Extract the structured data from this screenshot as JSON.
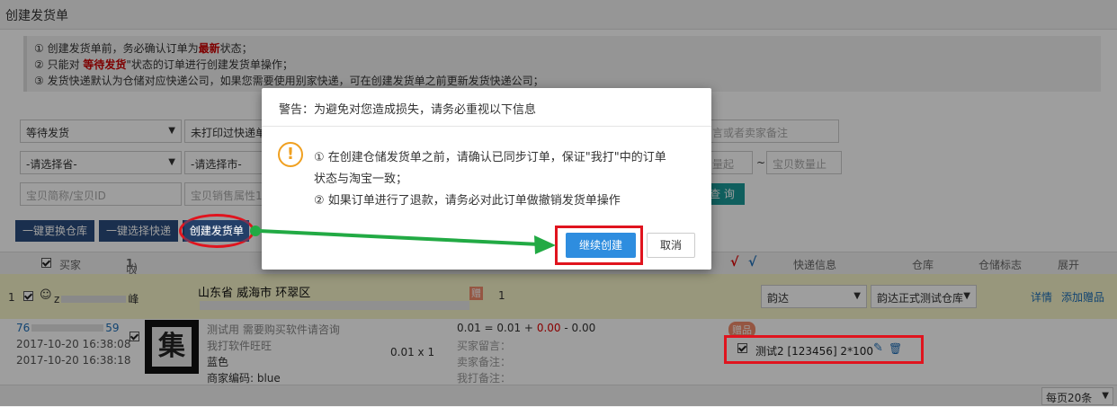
{
  "page_title": "创建发货单",
  "notice": {
    "line1_pre": "① 创建发货单前，务必确认订单为",
    "line1_em": "最新",
    "line1_post": "状态；",
    "line2_pre": "② 只能对 ",
    "line2_em": "等待发货",
    "line2_post": "\"状态的订单进行创建发货单操作；",
    "line3": "③ 发货快递默认为仓储对应快递公司，如果您需要使用别家快递，可在创建发货单之前更新发货快递公司；"
  },
  "filters": {
    "status_select": "等待发货",
    "print_select": "未打印过快递单",
    "province_select": "-请选择省-",
    "city_select": "-请选择市-",
    "remark_placeholder": "言或者卖家备注",
    "qty_from_placeholder": "量起",
    "tilde": "~",
    "qty_to_placeholder": "宝贝数量止",
    "item_name_placeholder": "宝贝简称/宝贝ID",
    "item_attr_placeholder": "宝贝销售属性1",
    "query_button": "查 询"
  },
  "toolbar": {
    "change_warehouse": "一键更换仓库",
    "choose_express": "一键选择快递",
    "create_shipment": "创建发货单"
  },
  "table_header": {
    "buyer": "买家",
    "receiver": "收件人(",
    "receiver_count": "1",
    "receiver_close": ")",
    "check_red": "√",
    "check_blue": "√",
    "express_info": "快递信息",
    "warehouse": "仓库",
    "storage_flag": "仓储标志",
    "expand": "展开"
  },
  "order": {
    "index": "1",
    "buyer_initial": "z",
    "buyer_suffix": "峰",
    "address": "山东省 威海市 环翠区",
    "gift_badge": "赠",
    "count": "1",
    "express_select": "韵达",
    "warehouse_select": "韵达正式测试仓库",
    "detail_link": "详情",
    "add_gift_link": "添加赠品"
  },
  "item": {
    "order_no_prefix": "76",
    "order_no_suffix": "59",
    "created_time": "2017-10-20 16:38:08",
    "paid_time": "2017-10-20 16:38:18",
    "thumb_char": "集",
    "title_line1": "测试用 需要购买软件请咨询",
    "title_line2": "我打软件旺旺",
    "color": "蓝色",
    "merchant_code": "商家编码: blue",
    "price_qty": "0.01 x 1",
    "formula_pre": "0.01 = 0.01 + ",
    "formula_red": "0.00",
    "formula_post": " - 0.00",
    "buyer_msg": "买家留言：",
    "seller_remark": "卖家备注：",
    "my_remark": "我打备注：",
    "gift_tag": "赠品",
    "gift_line": "测试2 [123456]  2*100"
  },
  "footer": {
    "per_page": "每页20条"
  },
  "dialog": {
    "title": "警告：为避免对您造成损失，请务必重视以下信息",
    "msg1": "① 在创建仓储发货单之前，请确认已同步订单，保证\"我打\"中的订单",
    "msg2": "状态与淘宝一致；",
    "msg3": "② 如果订单进行了退款，请务必对此订单做撤销发货单操作",
    "confirm": "继续创建",
    "cancel": "取消"
  },
  "colors": {
    "accent_blue": "#2e8ddf",
    "toolbar_dark": "#2b4d7e",
    "highlight_red": "#e0141e",
    "arrow_green": "#22aa44",
    "warning_orange": "#f0a020"
  }
}
